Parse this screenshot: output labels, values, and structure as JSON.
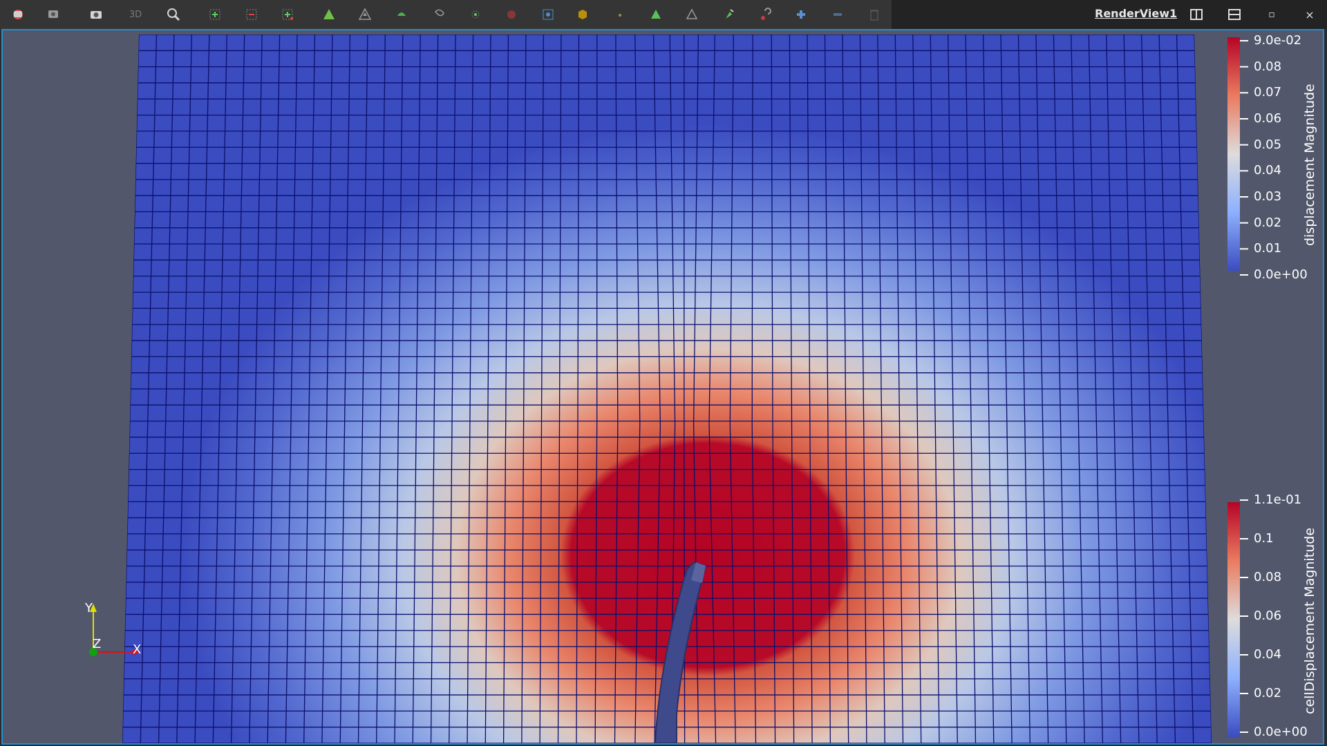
{
  "toolbar": {
    "buttons": [
      {
        "name": "reset-camera-icon",
        "icon": "camera-reset"
      },
      {
        "name": "reset-camera-closest-icon",
        "icon": "camera-reset-closest"
      },
      {
        "name": "capture-screenshot-icon",
        "icon": "camera"
      },
      {
        "name": "toggle-3d-button",
        "label": "3D"
      },
      {
        "name": "zoom-to-box-icon",
        "icon": "magnifier"
      },
      {
        "name": "select-cells-on-icon",
        "icon": "select-cells"
      },
      {
        "name": "select-points-on-icon",
        "icon": "select-points"
      },
      {
        "name": "select-cells-through-icon",
        "icon": "select-through"
      },
      {
        "name": "select-points-through-icon",
        "icon": "select-points-through"
      },
      {
        "name": "select-cells-polygon-icon",
        "icon": "polygon-cells"
      },
      {
        "name": "select-points-polygon-icon",
        "icon": "polygon-points"
      },
      {
        "name": "interactive-select-cells-icon",
        "icon": "interactive-cells"
      },
      {
        "name": "interactive-select-points-icon",
        "icon": "interactive-points"
      },
      {
        "name": "hover-points-icon",
        "icon": "hover-points"
      },
      {
        "name": "hover-cells-icon",
        "icon": "hover-cells"
      },
      {
        "name": "select-blocks-icon",
        "icon": "block"
      },
      {
        "name": "interactive-select-blocks-icon",
        "icon": "dot"
      },
      {
        "name": "grow-selection-icon",
        "icon": "triangle-filled"
      },
      {
        "name": "shrink-selection-icon",
        "icon": "triangle-outline"
      },
      {
        "name": "edit-selection-icon",
        "icon": "edit-triangle"
      },
      {
        "name": "clear-selection-icon",
        "icon": "question"
      },
      {
        "name": "add-selection-icon",
        "icon": "plus"
      },
      {
        "name": "subtract-selection-icon",
        "icon": "minus"
      },
      {
        "name": "delete-selection-icon",
        "icon": "trash"
      }
    ]
  },
  "view": {
    "title": "RenderView1",
    "split_horizontal": "split-horizontal-icon",
    "split_vertical": "split-vertical-icon",
    "maximize": "▫",
    "close": "×"
  },
  "legend_top": {
    "title": "displacement Magnitude",
    "ticks": [
      "9.0e-02",
      "0.08",
      "0.07",
      "0.06",
      "0.05",
      "0.04",
      "0.03",
      "0.02",
      "0.01",
      "0.0e+00"
    ],
    "range": [
      0,
      0.09
    ]
  },
  "legend_bottom": {
    "title": "cellDisplacement Magnitude",
    "ticks": [
      "1.1e-01",
      "0.1",
      "0.08",
      "0.06",
      "0.04",
      "0.02",
      "0.0e+00"
    ],
    "range": [
      0,
      0.11
    ]
  },
  "axes": {
    "y": "Y",
    "z": "Z",
    "x": "X"
  },
  "colors": {
    "viewport_bg": "#52576b",
    "low": "#3b4cc0",
    "mid": "#dddddd",
    "high": "#b40426",
    "mesh_line": "#0b0f6b",
    "accent": "#1f8fd6"
  }
}
